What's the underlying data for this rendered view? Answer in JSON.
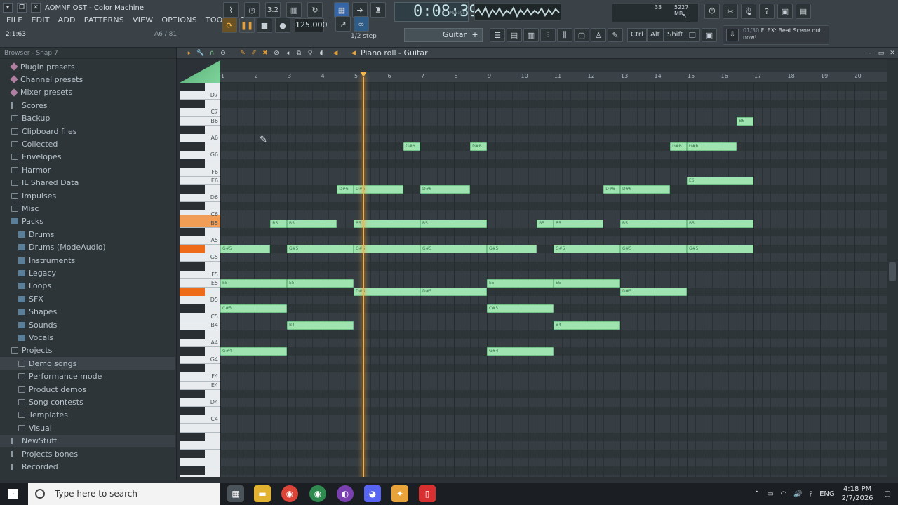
{
  "window": {
    "title": "AOMNF OST - Color Machine",
    "hint": "2:1:63",
    "hint_right": "A6 / 81"
  },
  "menu": [
    "FILE",
    "EDIT",
    "ADD",
    "PATTERNS",
    "VIEW",
    "OPTIONS",
    "TOOLS",
    "?"
  ],
  "transport": {
    "tempo": "125.000",
    "time": "0:08:39",
    "time_label": "M:S:CS",
    "step": "1/2 step",
    "channel": "Guitar",
    "channel_add": "+",
    "mem_cpu": "33",
    "mem_mb": "5227 MB",
    "mem_voices": "5",
    "keys": [
      "Ctrl",
      "Alt",
      "Shift"
    ]
  },
  "news": {
    "count": "01/30",
    "text": "FLEX: Beat Scene out now!"
  },
  "browser": {
    "header": "Browser - Snap 7",
    "items": [
      {
        "label": "Plugin presets",
        "icon": "pink"
      },
      {
        "label": "Channel presets",
        "icon": "pink"
      },
      {
        "label": "Mixer presets",
        "icon": "pink"
      },
      {
        "label": "Scores",
        "icon": "note"
      },
      {
        "label": "Backup",
        "icon": "folder"
      },
      {
        "label": "Clipboard files",
        "icon": "folder"
      },
      {
        "label": "Collected",
        "icon": "folder"
      },
      {
        "label": "Envelopes",
        "icon": "folder"
      },
      {
        "label": "Harmor",
        "icon": "folder"
      },
      {
        "label": "IL Shared Data",
        "icon": "folder"
      },
      {
        "label": "Impulses",
        "icon": "folder"
      },
      {
        "label": "Misc",
        "icon": "folder"
      },
      {
        "label": "Packs",
        "icon": "blue"
      },
      {
        "label": "Drums",
        "icon": "blue",
        "indent": true
      },
      {
        "label": "Drums (ModeAudio)",
        "icon": "blue",
        "indent": true
      },
      {
        "label": "Instruments",
        "icon": "blue",
        "indent": true
      },
      {
        "label": "Legacy",
        "icon": "blue",
        "indent": true
      },
      {
        "label": "Loops",
        "icon": "blue",
        "indent": true
      },
      {
        "label": "SFX",
        "icon": "blue",
        "indent": true
      },
      {
        "label": "Shapes",
        "icon": "blue",
        "indent": true
      },
      {
        "label": "Sounds",
        "icon": "blue",
        "indent": true
      },
      {
        "label": "Vocals",
        "icon": "blue",
        "indent": true
      },
      {
        "label": "Projects",
        "icon": "folder"
      },
      {
        "label": "Demo songs",
        "icon": "folder",
        "indent": true
      },
      {
        "label": "Performance mode",
        "icon": "folder",
        "indent": true
      },
      {
        "label": "Product demos",
        "icon": "folder",
        "indent": true
      },
      {
        "label": "Song contests",
        "icon": "folder",
        "indent": true
      },
      {
        "label": "Templates",
        "icon": "folder",
        "indent": true
      },
      {
        "label": "Visual",
        "icon": "folder",
        "indent": true
      },
      {
        "label": "NewStuff",
        "icon": "plain"
      },
      {
        "label": "Projects bones",
        "icon": "plain"
      },
      {
        "label": "Recorded",
        "icon": "plus"
      }
    ]
  },
  "piano_roll": {
    "title": "Piano roll - Guitar",
    "bars": [
      "1",
      "2",
      "3",
      "4",
      "5",
      "6",
      "7",
      "8",
      "9",
      "10",
      "11",
      "12",
      "13",
      "14",
      "15",
      "16",
      "17",
      "18",
      "19",
      "20"
    ],
    "key_labels": [
      "D7",
      "C7",
      "B6",
      "A6",
      "G6",
      "F6",
      "E6",
      "D6",
      "C6",
      "B5",
      "A5",
      "G5",
      "F5",
      "E5",
      "D5",
      "C5",
      "B4",
      "A4",
      "G4",
      "F4",
      "E4",
      "D4",
      "C4"
    ],
    "playhead_bar": 5.3,
    "notes": [
      {
        "pitch": "B6",
        "label": "B6",
        "start": 16.5,
        "len": 0.5
      },
      {
        "pitch": "G#6",
        "label": "G#6",
        "start": 6.5,
        "len": 0.5
      },
      {
        "pitch": "G#6",
        "label": "G#6",
        "start": 8.5,
        "len": 0.5
      },
      {
        "pitch": "G#6",
        "label": "G#6",
        "start": 14.5,
        "len": 0.5
      },
      {
        "pitch": "G#6",
        "label": "G#6",
        "start": 15.0,
        "len": 1.5
      },
      {
        "pitch": "E6",
        "label": "E6",
        "start": 15.0,
        "len": 2.0
      },
      {
        "pitch": "D#6",
        "label": "D#6",
        "start": 4.5,
        "len": 0.5
      },
      {
        "pitch": "D#6",
        "label": "D#6",
        "start": 5.0,
        "len": 1.5
      },
      {
        "pitch": "D#6",
        "label": "D#6",
        "start": 7.0,
        "len": 1.5
      },
      {
        "pitch": "D#6",
        "label": "D#6",
        "start": 12.5,
        "len": 0.5
      },
      {
        "pitch": "D#6",
        "label": "D#6",
        "start": 13.0,
        "len": 1.5
      },
      {
        "pitch": "B5",
        "label": "B5",
        "start": 2.5,
        "len": 0.5
      },
      {
        "pitch": "B5",
        "label": "B5",
        "start": 3.0,
        "len": 1.5
      },
      {
        "pitch": "B5",
        "label": "B5",
        "start": 5.0,
        "len": 2.0
      },
      {
        "pitch": "B5",
        "label": "B5",
        "start": 7.0,
        "len": 2.0
      },
      {
        "pitch": "B5",
        "label": "B5",
        "start": 10.5,
        "len": 0.5
      },
      {
        "pitch": "B5",
        "label": "B5",
        "start": 11.0,
        "len": 1.5
      },
      {
        "pitch": "B5",
        "label": "B5",
        "start": 13.0,
        "len": 2.0
      },
      {
        "pitch": "B5",
        "label": "B5",
        "start": 15.0,
        "len": 2.0
      },
      {
        "pitch": "G#5",
        "label": "G#5",
        "start": 1.0,
        "len": 1.5
      },
      {
        "pitch": "G#5",
        "label": "G#5",
        "start": 3.0,
        "len": 2.0
      },
      {
        "pitch": "G#5",
        "label": "G#5",
        "start": 5.0,
        "len": 2.0
      },
      {
        "pitch": "G#5",
        "label": "G#5",
        "start": 7.0,
        "len": 2.0
      },
      {
        "pitch": "G#5",
        "label": "G#5",
        "start": 9.0,
        "len": 1.5
      },
      {
        "pitch": "G#5",
        "label": "G#5",
        "start": 11.0,
        "len": 2.0
      },
      {
        "pitch": "G#5",
        "label": "G#5",
        "start": 13.0,
        "len": 2.0
      },
      {
        "pitch": "G#5",
        "label": "G#5",
        "start": 15.0,
        "len": 2.0
      },
      {
        "pitch": "E5",
        "label": "E5",
        "start": 1.0,
        "len": 2.0
      },
      {
        "pitch": "E5",
        "label": "E5",
        "start": 3.0,
        "len": 2.0
      },
      {
        "pitch": "E5",
        "label": "E5",
        "start": 9.0,
        "len": 2.0
      },
      {
        "pitch": "E5",
        "label": "E5",
        "start": 11.0,
        "len": 2.0
      },
      {
        "pitch": "D#5",
        "label": "D#5",
        "start": 5.0,
        "len": 2.0
      },
      {
        "pitch": "D#5",
        "label": "D#5",
        "start": 7.0,
        "len": 2.0
      },
      {
        "pitch": "D#5",
        "label": "D#5",
        "start": 13.0,
        "len": 2.0
      },
      {
        "pitch": "C#5",
        "label": "C#5",
        "start": 1.0,
        "len": 2.0
      },
      {
        "pitch": "C#5",
        "label": "C#5",
        "start": 9.0,
        "len": 2.0
      },
      {
        "pitch": "B4",
        "label": "B4",
        "start": 3.0,
        "len": 2.0
      },
      {
        "pitch": "B4",
        "label": "B4",
        "start": 11.0,
        "len": 2.0
      },
      {
        "pitch": "G#4",
        "label": "G#4",
        "start": 1.0,
        "len": 2.0
      },
      {
        "pitch": "G#4",
        "label": "G#4",
        "start": 9.0,
        "len": 2.0
      }
    ]
  },
  "taskbar": {
    "search_placeholder": "Type here to search",
    "language": "ENG",
    "time": "4:18 PM",
    "date": "2/7/2026"
  },
  "colors": {
    "note_fill": "#9ee3b0",
    "playhead": "#f0b24e",
    "highlight_key": "#ee6b1a"
  }
}
